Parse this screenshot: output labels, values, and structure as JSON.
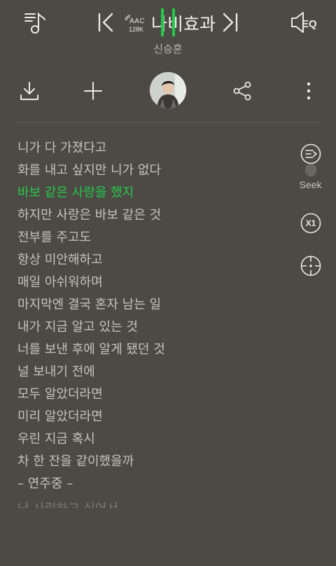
{
  "header": {
    "codec_format": "AAC",
    "codec_bitrate": "128K",
    "song_title": "나비효과",
    "artist": "신승훈"
  },
  "actions": {
    "download": "download-icon",
    "add": "plus-icon",
    "share": "share-icon",
    "more": "more-vertical-icon"
  },
  "lyrics": {
    "lines": [
      "니가 다 가졌다고",
      "화를 내고 싶지만 니가 없다",
      "바보 같은 사랑을 했지",
      "하지만 사랑은 바보 같은 것",
      "전부를 주고도",
      "항상 미안해하고",
      "매일 아쉬워하며",
      "마지막엔 결국 혼자 남는 일",
      "내가 지금 알고 있는 것",
      "너를 보낸 후에 알게 됐던 것",
      "널 보내기 전에",
      "모두 알았더라면",
      "미리 알았더라면",
      "우린 지금 혹시",
      "차 한 잔을 같이했을까",
      "– 연주중 –",
      "난 사랑하고 싶어서"
    ],
    "active_index": 2
  },
  "side_controls": {
    "seek_label": "Seek",
    "speed_label": "X1"
  },
  "colors": {
    "background": "#4d4a45",
    "accent": "#24c84b"
  }
}
